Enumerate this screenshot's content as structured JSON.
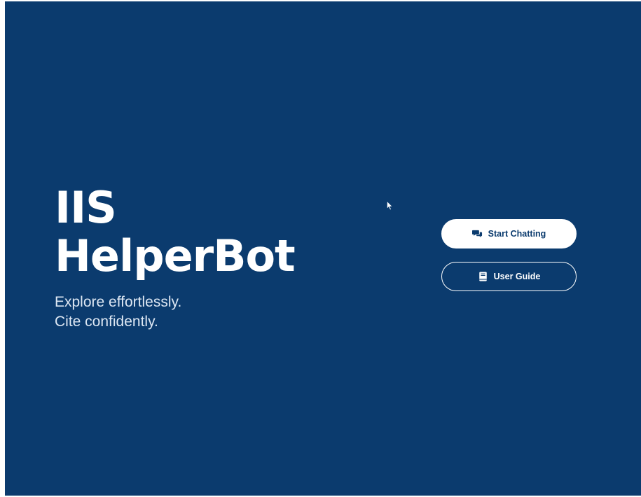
{
  "hero": {
    "title_line_1": "IIS",
    "title_line_2": "HelperBot",
    "tagline_line_1": "Explore effortlessly.",
    "tagline_line_2": "Cite confidently."
  },
  "actions": {
    "start_chatting_label": "Start Chatting",
    "start_chatting_icon": "chat-bubbles-icon",
    "user_guide_label": "User Guide",
    "user_guide_icon": "book-icon"
  },
  "colors": {
    "background": "#0b3b6e",
    "primary_button_bg": "#ffffff",
    "primary_button_text": "#0b3b6e",
    "text": "#ffffff"
  }
}
